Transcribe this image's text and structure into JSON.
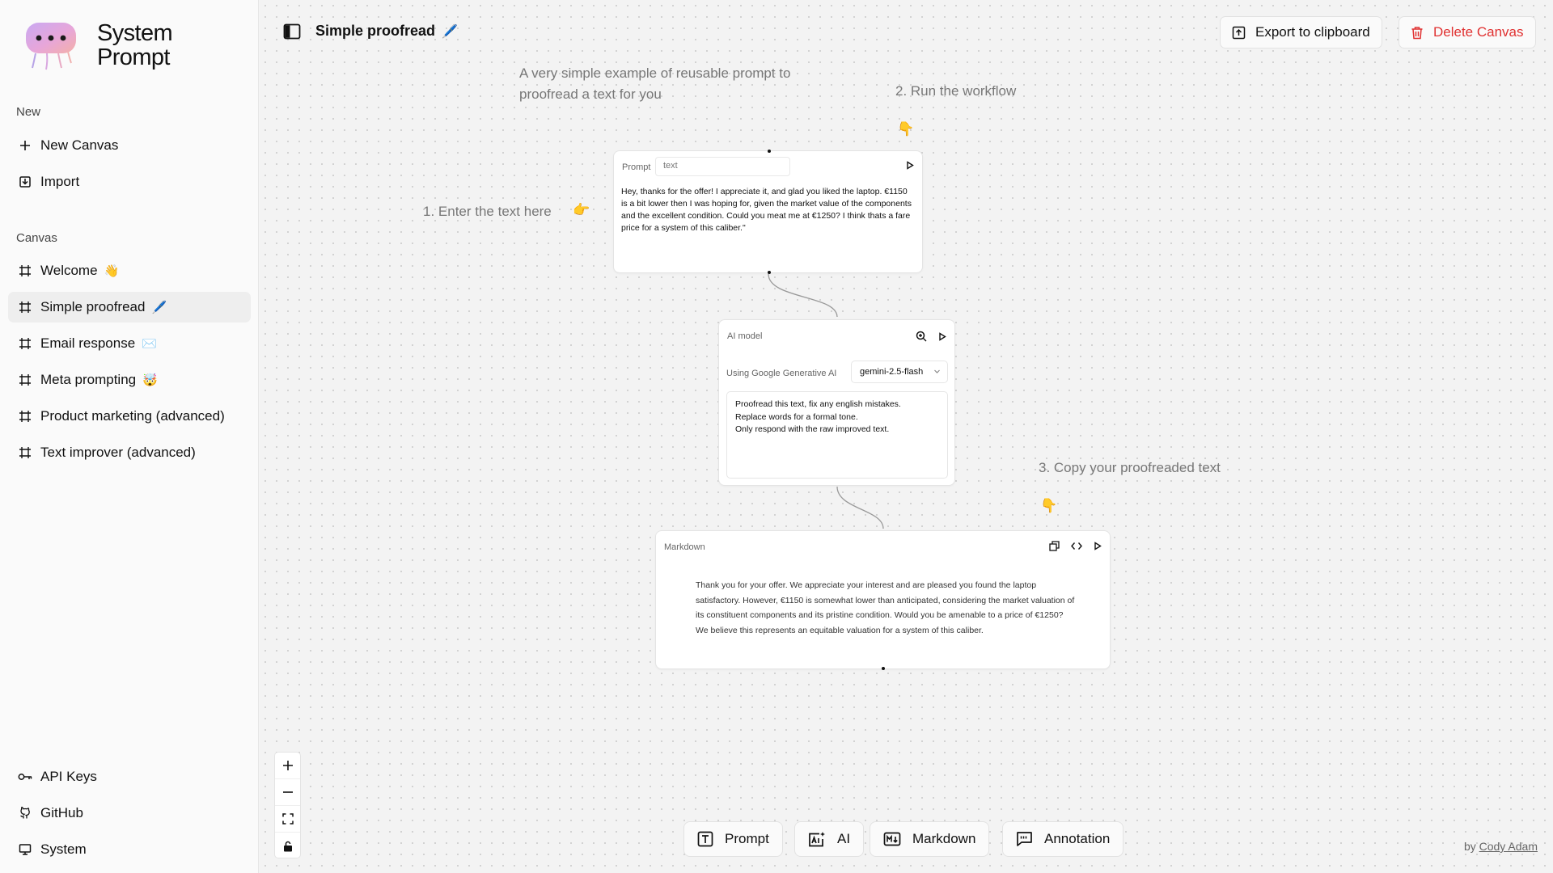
{
  "app": {
    "brand_line1": "System",
    "brand_line2": "Prompt",
    "accent": "#e03131"
  },
  "sidebar": {
    "new_section": "New",
    "new_items": [
      {
        "label": "New Canvas",
        "icon": "plus-icon"
      },
      {
        "label": "Import",
        "icon": "import-icon"
      }
    ],
    "canvas_section": "Canvas",
    "canvas_items": [
      {
        "label": "Welcome",
        "emoji": "👋"
      },
      {
        "label": "Simple proofread",
        "emoji": "🖊️",
        "active": true
      },
      {
        "label": "Email response",
        "emoji": "✉️"
      },
      {
        "label": "Meta prompting",
        "emoji": "🤯"
      },
      {
        "label": "Product marketing (advanced)",
        "emoji": ""
      },
      {
        "label": "Text improver (advanced)",
        "emoji": ""
      }
    ],
    "footer_items": [
      {
        "label": "API Keys",
        "icon": "key-icon"
      },
      {
        "label": "GitHub",
        "icon": "github-icon"
      },
      {
        "label": "System",
        "icon": "monitor-icon"
      }
    ]
  },
  "header": {
    "title": "Simple proofread",
    "title_emoji": "🖊️",
    "export_label": "Export to clipboard",
    "delete_label": "Delete Canvas"
  },
  "annotations": {
    "intro_line1": "A very simple example of reusable prompt to",
    "intro_line2": "proofread a text for you",
    "step1": "1. Enter the text here",
    "step1_emoji": "👉",
    "step2": "2. Run the workflow",
    "step2_emoji": "👇",
    "step3": "3. Copy your proofreaded text",
    "step3_emoji": "👇"
  },
  "prompt_node": {
    "label": "Prompt",
    "name_value": "text",
    "text": "Hey, thanks for the offer! I appreciate it, and glad you liked the laptop. €1150 is a bit lower then I was hoping for, given the market value of the components and the excellent condition. Could you meat me at €1250? I think thats a fare price for a system of this caliber.\""
  },
  "ai_node": {
    "label": "AI model",
    "provider": "Using Google Generative AI",
    "model": "gemini-2.5-flash",
    "instructions": [
      "Proofread this text, fix any english mistakes.",
      "Replace words for a formal tone.",
      "Only respond with the raw improved text."
    ]
  },
  "markdown_node": {
    "label": "Markdown",
    "output": "Thank you for your offer. We appreciate your interest and are pleased you found the laptop satisfactory. However, €1150 is somewhat lower than anticipated, considering the market valuation of its constituent components and its pristine condition. Would you be amenable to a price of €1250? We believe this represents an equitable valuation for a system of this caliber."
  },
  "toolbar": {
    "prompt_label": "Prompt",
    "ai_label": "AI",
    "markdown_label": "Markdown",
    "annotation_label": "Annotation"
  },
  "footer": {
    "by": "by",
    "author": "Cody Adam"
  }
}
